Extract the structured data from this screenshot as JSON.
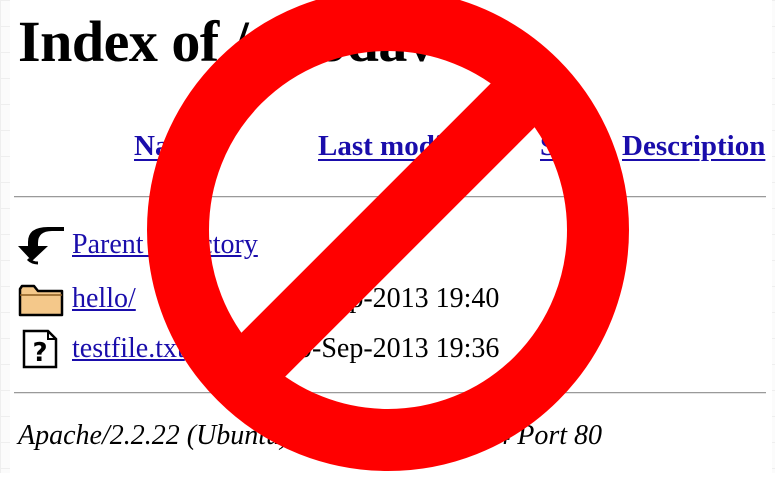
{
  "page": {
    "title": "Index of /webdav"
  },
  "columns": {
    "name": "Name",
    "last_modified": "Last modified",
    "size": "Size",
    "description": "Description"
  },
  "entries": [
    {
      "icon": "back-arrow-icon",
      "name": "Parent Directory",
      "modified": "",
      "size": "-"
    },
    {
      "icon": "folder-icon",
      "name": "hello/",
      "modified": "10-Sep-2013 19:40",
      "size": "-"
    },
    {
      "icon": "unknown-file-icon",
      "name": "testfile.txt",
      "modified": "10-Sep-2013 19:36",
      "size": ""
    }
  ],
  "footer": {
    "signature": "Apache/2.2.22 (Ubuntu) Server at 10.3.2.14 Port 80"
  },
  "overlay": {
    "icon": "prohibition-icon",
    "color": "#ff0000"
  },
  "colors": {
    "link": "#1a0dab",
    "text": "#000000",
    "background": "#ffffff"
  }
}
